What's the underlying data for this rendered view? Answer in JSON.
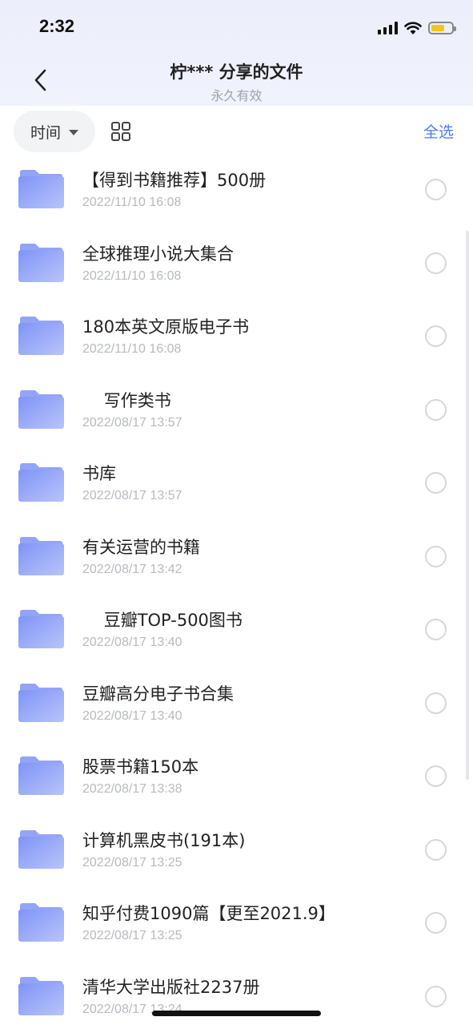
{
  "status_bar": {
    "time": "2:32",
    "battery_color": "#f5c518"
  },
  "header": {
    "title": "柠*** 分享的文件",
    "subtitle": "永久有效",
    "back_icon": "chevron-left-icon"
  },
  "toolbar": {
    "sort_label": "时间",
    "view_icon": "grid-view-icon",
    "select_all_label": "全选",
    "accent_color": "#4a7cf0"
  },
  "files": [
    {
      "name": "【得到书籍推荐】500册",
      "date": "2022/11/10 16:08"
    },
    {
      "name": "全球推理小说大集合",
      "date": "2022/11/10 16:08"
    },
    {
      "name": "180本英文原版电子书",
      "date": "2022/11/10 16:08"
    },
    {
      "name": "    写作类书",
      "date": "2022/08/17 13:57"
    },
    {
      "name": "书库",
      "date": "2022/08/17 13:57"
    },
    {
      "name": "有关运营的书籍",
      "date": "2022/08/17 13:42"
    },
    {
      "name": "    豆瓣TOP-500图书",
      "date": "2022/08/17 13:40"
    },
    {
      "name": "豆瓣高分电子书合集",
      "date": "2022/08/17 13:40"
    },
    {
      "name": "股票书籍150本",
      "date": "2022/08/17 13:38"
    },
    {
      "name": "计算机黑皮书(191本)",
      "date": "2022/08/17 13:25"
    },
    {
      "name": "知乎付费1090篇【更至2021.9】",
      "date": "2022/08/17 13:25"
    },
    {
      "name": "清华大学出版社2237册",
      "date": "2022/08/17 13:24"
    }
  ]
}
